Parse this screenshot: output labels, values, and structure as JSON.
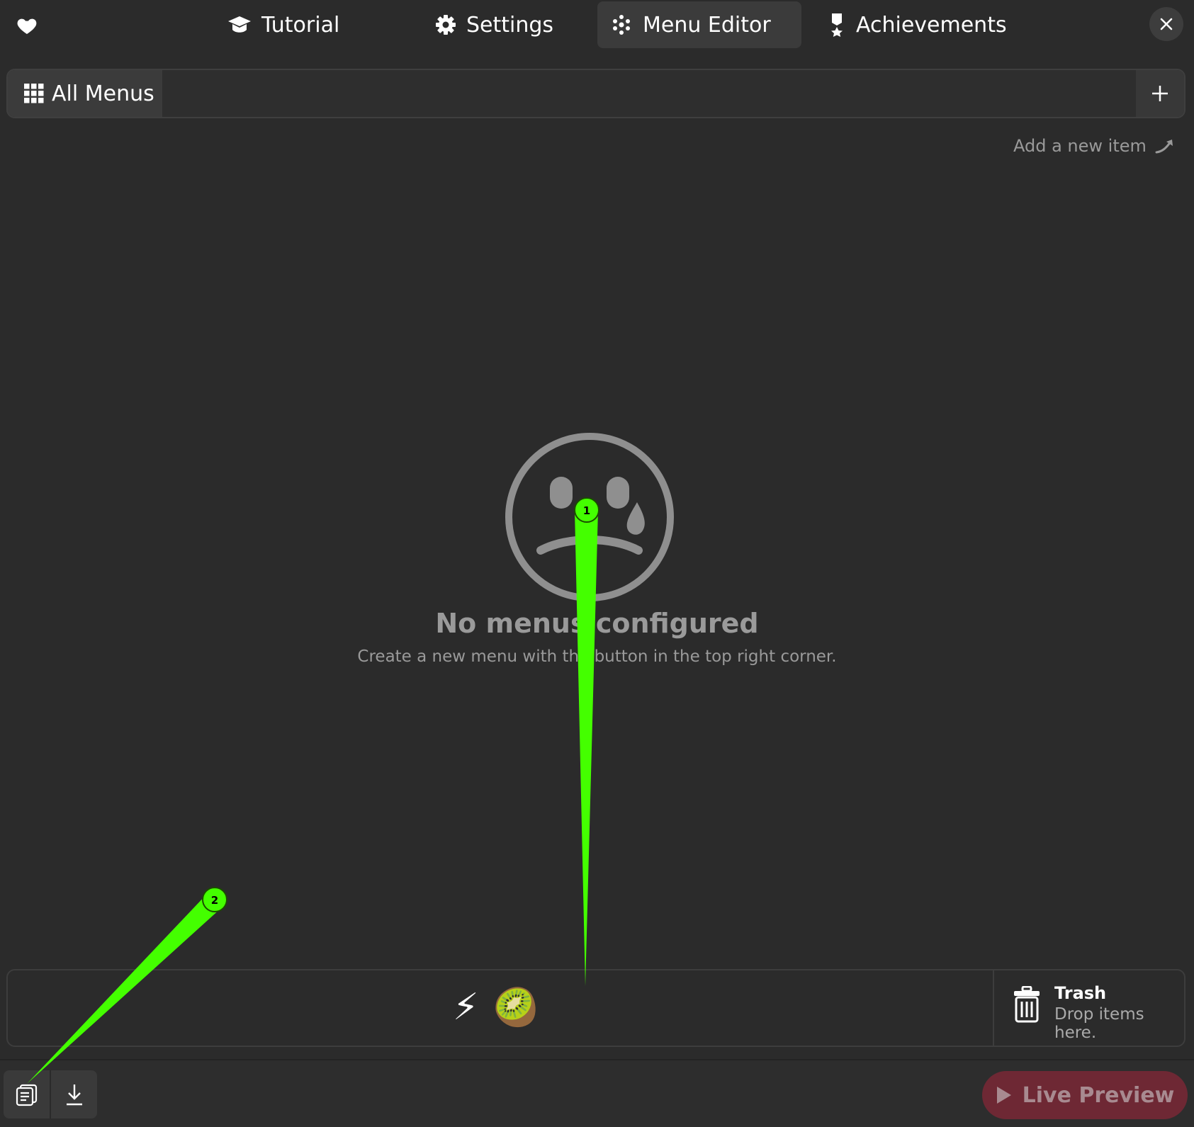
{
  "nav": {
    "tabs": [
      {
        "label": "Tutorial",
        "icon": "graduation-cap-icon"
      },
      {
        "label": "Settings",
        "icon": "gear-icon"
      },
      {
        "label": "Menu Editor",
        "icon": "menu-dots-icon",
        "active": true
      },
      {
        "label": "Achievements",
        "icon": "medal-icon"
      }
    ]
  },
  "menus_bar": {
    "all_menus_label": "All Menus"
  },
  "hint": {
    "add_new_item": "Add a new item"
  },
  "empty_state": {
    "title": "No menus configured",
    "subtitle": "Create a new menu with the button in the top right corner."
  },
  "stash": {
    "items": [
      "⚡",
      "🥝"
    ]
  },
  "trash": {
    "title": "Trash",
    "subtitle": "Drop items here."
  },
  "bottom": {
    "live_preview_label": "Live Preview"
  },
  "annotations": [
    {
      "label": "1"
    },
    {
      "label": "2"
    }
  ],
  "colors": {
    "background": "#2b2b2b",
    "active_tab": "#3b3b3b",
    "live_preview": "#6e2834",
    "annotation": "#44ff00"
  }
}
